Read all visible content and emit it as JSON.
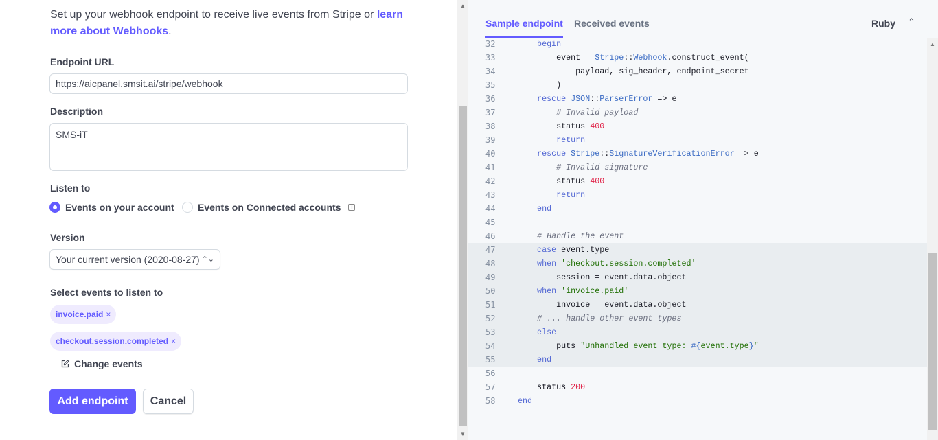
{
  "form": {
    "intro_text": "Set up your webhook endpoint to receive live events from Stripe or ",
    "intro_link": "learn more about Webhooks",
    "intro_end": ".",
    "endpoint_url_label": "Endpoint URL",
    "endpoint_url_value": "https://aicpanel.smsit.ai/stripe/webhook",
    "description_label": "Description",
    "description_value": "SMS-iT",
    "listen_to_label": "Listen to",
    "listen_options": [
      {
        "label": "Events on your account",
        "selected": true
      },
      {
        "label": "Events on Connected accounts",
        "selected": false
      }
    ],
    "version_label": "Version",
    "version_value": "Your current version (2020-08-27)",
    "events_label": "Select events to listen to",
    "events": [
      "invoice.paid",
      "checkout.session.completed"
    ],
    "remove_symbol": "×",
    "change_events": "Change events",
    "add_button": "Add endpoint",
    "cancel_button": "Cancel"
  },
  "code_panel": {
    "tabs": [
      {
        "label": "Sample endpoint",
        "active": true
      },
      {
        "label": "Received events",
        "active": false
      }
    ],
    "language": "Ruby",
    "highlighted_lines": [
      47,
      55
    ],
    "lines": [
      {
        "n": 32,
        "t": [
          [
            "k",
            "    begin"
          ]
        ]
      },
      {
        "n": 33,
        "t": [
          [
            "p",
            "        event = "
          ],
          [
            "c",
            "Stripe"
          ],
          [
            "p",
            "::"
          ],
          [
            "c",
            "Webhook"
          ],
          [
            "p",
            ".construct_event("
          ]
        ]
      },
      {
        "n": 34,
        "t": [
          [
            "p",
            "            payload, sig_header, endpoint_secret"
          ]
        ]
      },
      {
        "n": 35,
        "t": [
          [
            "p",
            "        )"
          ]
        ]
      },
      {
        "n": 36,
        "t": [
          [
            "k",
            "    rescue "
          ],
          [
            "c",
            "JSON"
          ],
          [
            "p",
            "::"
          ],
          [
            "c",
            "ParserError"
          ],
          [
            "p",
            " => e"
          ]
        ]
      },
      {
        "n": 37,
        "t": [
          [
            "m",
            "        # Invalid payload"
          ]
        ]
      },
      {
        "n": 38,
        "t": [
          [
            "p",
            "        status "
          ],
          [
            "n",
            "400"
          ]
        ]
      },
      {
        "n": 39,
        "t": [
          [
            "k",
            "        return"
          ]
        ]
      },
      {
        "n": 40,
        "t": [
          [
            "k",
            "    rescue "
          ],
          [
            "c",
            "Stripe"
          ],
          [
            "p",
            "::"
          ],
          [
            "c",
            "SignatureVerificationError"
          ],
          [
            "p",
            " => e"
          ]
        ]
      },
      {
        "n": 41,
        "t": [
          [
            "m",
            "        # Invalid signature"
          ]
        ]
      },
      {
        "n": 42,
        "t": [
          [
            "p",
            "        status "
          ],
          [
            "n",
            "400"
          ]
        ]
      },
      {
        "n": 43,
        "t": [
          [
            "k",
            "        return"
          ]
        ]
      },
      {
        "n": 44,
        "t": [
          [
            "k",
            "    end"
          ]
        ]
      },
      {
        "n": 45,
        "t": []
      },
      {
        "n": 46,
        "t": [
          [
            "m",
            "    # Handle the event"
          ]
        ]
      },
      {
        "n": 47,
        "t": [
          [
            "k",
            "    case "
          ],
          [
            "p",
            "event.type"
          ]
        ]
      },
      {
        "n": 48,
        "t": [
          [
            "k",
            "    when "
          ],
          [
            "s",
            "'checkout.session.completed'"
          ]
        ]
      },
      {
        "n": 49,
        "t": [
          [
            "p",
            "        session = event.data.object"
          ]
        ]
      },
      {
        "n": 50,
        "t": [
          [
            "k",
            "    when "
          ],
          [
            "s",
            "'invoice.paid'"
          ]
        ]
      },
      {
        "n": 51,
        "t": [
          [
            "p",
            "        invoice = event.data.object"
          ]
        ]
      },
      {
        "n": 52,
        "t": [
          [
            "m",
            "    # ... handle other event types"
          ]
        ]
      },
      {
        "n": 53,
        "t": [
          [
            "k",
            "    else"
          ]
        ]
      },
      {
        "n": 54,
        "t": [
          [
            "p",
            "        puts "
          ],
          [
            "s",
            "\"Unhandled event type: "
          ],
          [
            "c",
            "#{"
          ],
          [
            "s",
            "event.type"
          ],
          [
            "c",
            "}"
          ],
          [
            "s",
            "\""
          ]
        ]
      },
      {
        "n": 55,
        "t": [
          [
            "k",
            "    end"
          ]
        ]
      },
      {
        "n": 56,
        "t": []
      },
      {
        "n": 57,
        "t": [
          [
            "p",
            "    status "
          ],
          [
            "n",
            "200"
          ]
        ]
      },
      {
        "n": 58,
        "t": [
          [
            "k",
            "end"
          ]
        ]
      }
    ]
  },
  "colors": {
    "accent": "#635bff",
    "chip_bg": "#efebfe",
    "code_bg": "#f6f8fa",
    "highlight_bg": "#e9edf0"
  }
}
